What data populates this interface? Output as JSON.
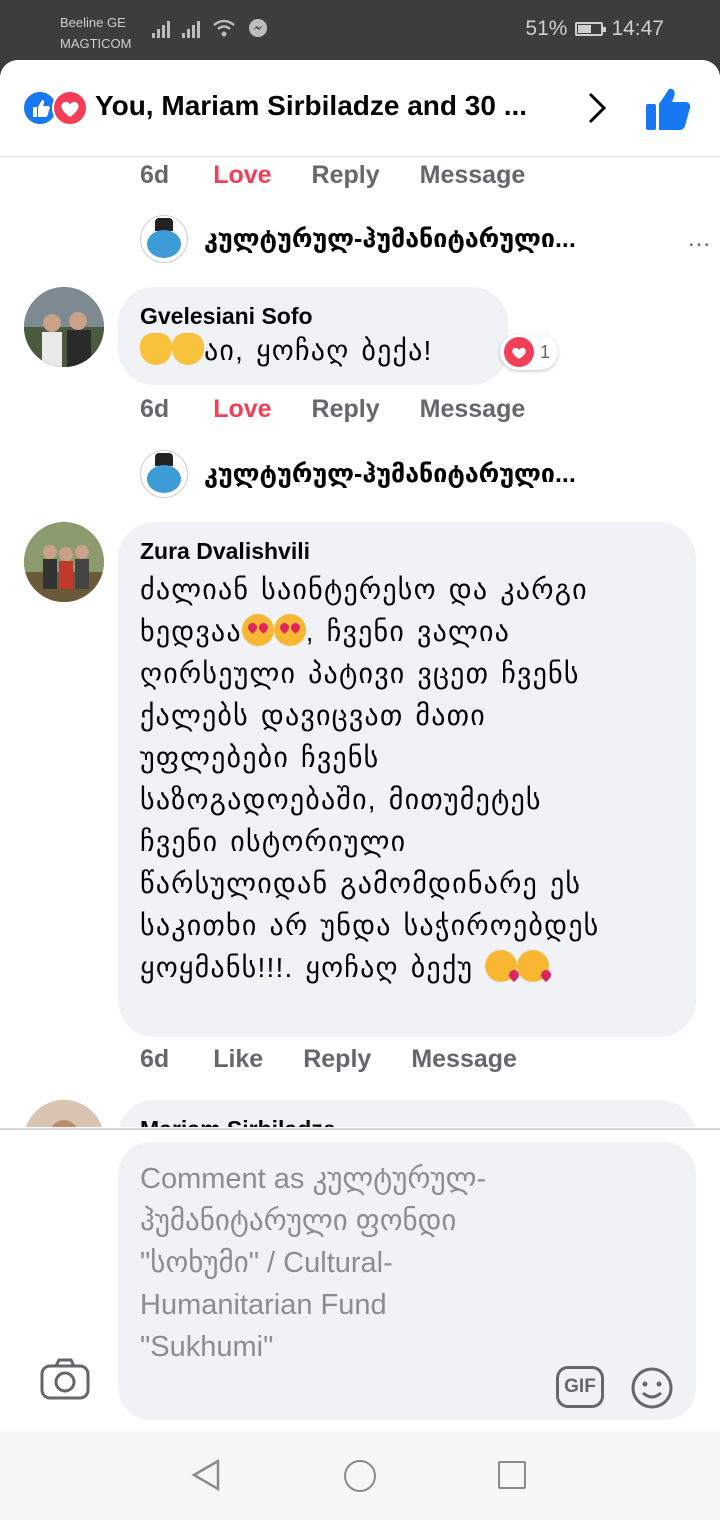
{
  "status_bar": {
    "carrier1": "Beeline GE",
    "carrier2": "MAGTICOM",
    "battery": "51%",
    "time": "14:47"
  },
  "header": {
    "reactions_summary": "You, Mariam Sirbiladze and 30 ..."
  },
  "actions": {
    "time": "6d",
    "love": "Love",
    "like": "Like",
    "reply": "Reply",
    "message": "Message"
  },
  "page_reply": {
    "name": "კულტურულ-ჰუმანიტარული...",
    "more": "..."
  },
  "comments": [
    {
      "author": "Gvelesiani Sofo",
      "text": "აი, ყოჩაღ ბექა!",
      "reaction_count": "1"
    },
    {
      "author": "Zura Dvalishvili",
      "lines": [
        "ძალიან საინტერესო და კარგი",
        "ხედვაა",
        ", ჩვენი ვალია",
        "ღირსეული პატივი ვცეთ ჩვენს",
        "ქალებს დავიცვათ მათი",
        "უფლებები ჩვენს",
        "საზოგადოებაში, მითუმეტეს",
        "ჩვენი ისტორიული",
        "წარსულიდან გამომდინარე ეს",
        "საკითხი არ უნდა საჭიროებდეს",
        "ყოყმანს!!!. ყოჩაღ ბექუ"
      ]
    },
    {
      "author": "Mariam Sirbiladze"
    }
  ],
  "composer": {
    "placeholder": "Comment as კულტურულ-ჰუმანიტარული ფონდი \"სოხუმი\" / Cultural-Humanitarian Fund \"Sukhumi\"",
    "gif_label": "GIF"
  },
  "colors": {
    "love": "#f33e58",
    "like_blue": "#1877f2",
    "bubble": "#f0f2f5"
  }
}
